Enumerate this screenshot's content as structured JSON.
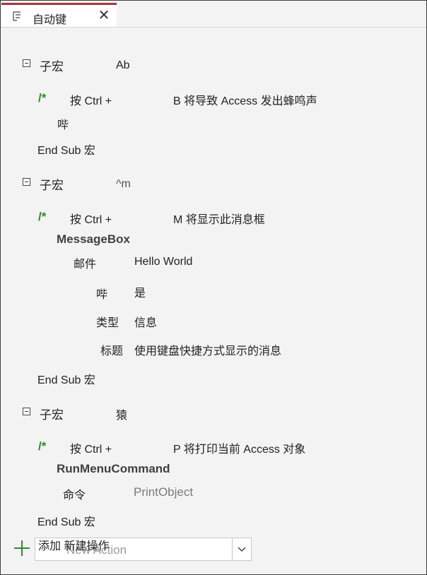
{
  "tab": {
    "title": "自动键",
    "close": "✕",
    "icon": "macro-icon"
  },
  "blocks": [
    {
      "submacro_label": "子宏",
      "submacro_name": "Ab",
      "comment_mark": "/*",
      "comment_prefix": "按 Ctrl +",
      "comment_text": "B 将导致 Access 发出蜂鸣声",
      "action": "哔",
      "end": "End Sub 宏"
    },
    {
      "submacro_label": "子宏",
      "submacro_name": "^m",
      "comment_mark": "/*",
      "comment_prefix": "按 Ctrl +",
      "comment_text": "M 将显示此消息框",
      "action": "MessageBox",
      "args": [
        {
          "label": "邮件",
          "value": "Hello World"
        },
        {
          "label": "哔",
          "value": "是"
        },
        {
          "label": "类型",
          "value": "信息"
        },
        {
          "label": "标题",
          "value": "使用键盘快捷方式显示的消息"
        }
      ],
      "end": "End Sub 宏"
    },
    {
      "submacro_label": "子宏",
      "submacro_name": "猿",
      "comment_mark": "/*",
      "comment_prefix": "按 Ctrl +",
      "comment_text": "P 将打印当前 Access 对象",
      "action": "RunMenuCommand",
      "args": [
        {
          "label": "命令",
          "value": "PrintObject"
        }
      ],
      "end": "End Sub 宏"
    }
  ],
  "add_action": {
    "label": "添加 新建操作",
    "placeholder": "New Action"
  },
  "colors": {
    "tab_accent": "#a4373a",
    "comment": "#2e8b2e",
    "plus": "#2e8b2e"
  }
}
